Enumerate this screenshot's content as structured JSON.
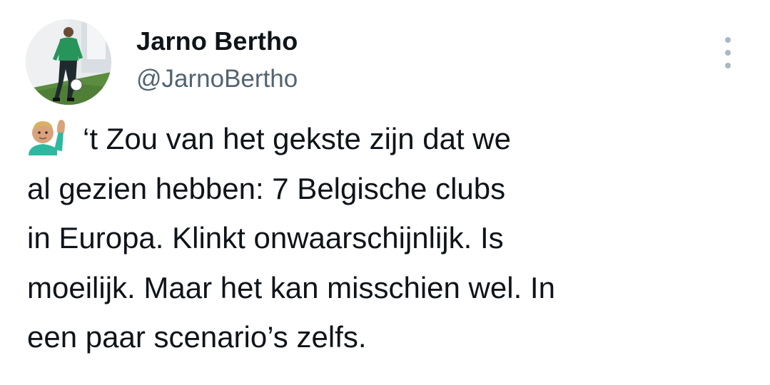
{
  "tweet": {
    "author": {
      "name": "Jarno Bertho",
      "handle": "@JarnoBertho",
      "avatar_icon": "profile-photo"
    },
    "more_icon": "vertical-ellipsis-icon",
    "emoji": "man-raising-hand",
    "text_lines": [
      "‘t Zou van het gekste zijn dat we",
      "al gezien hebben: 7 Belgische clubs",
      "in Europa. Klinkt onwaarschijnlijk. Is",
      "moeilijk. Maar het kan misschien wel. In",
      "een paar scenario’s zelfs."
    ]
  },
  "colors": {
    "text": "#0f1419",
    "secondary": "#536471",
    "more_dots": "#aab8c2",
    "background": "#ffffff"
  }
}
